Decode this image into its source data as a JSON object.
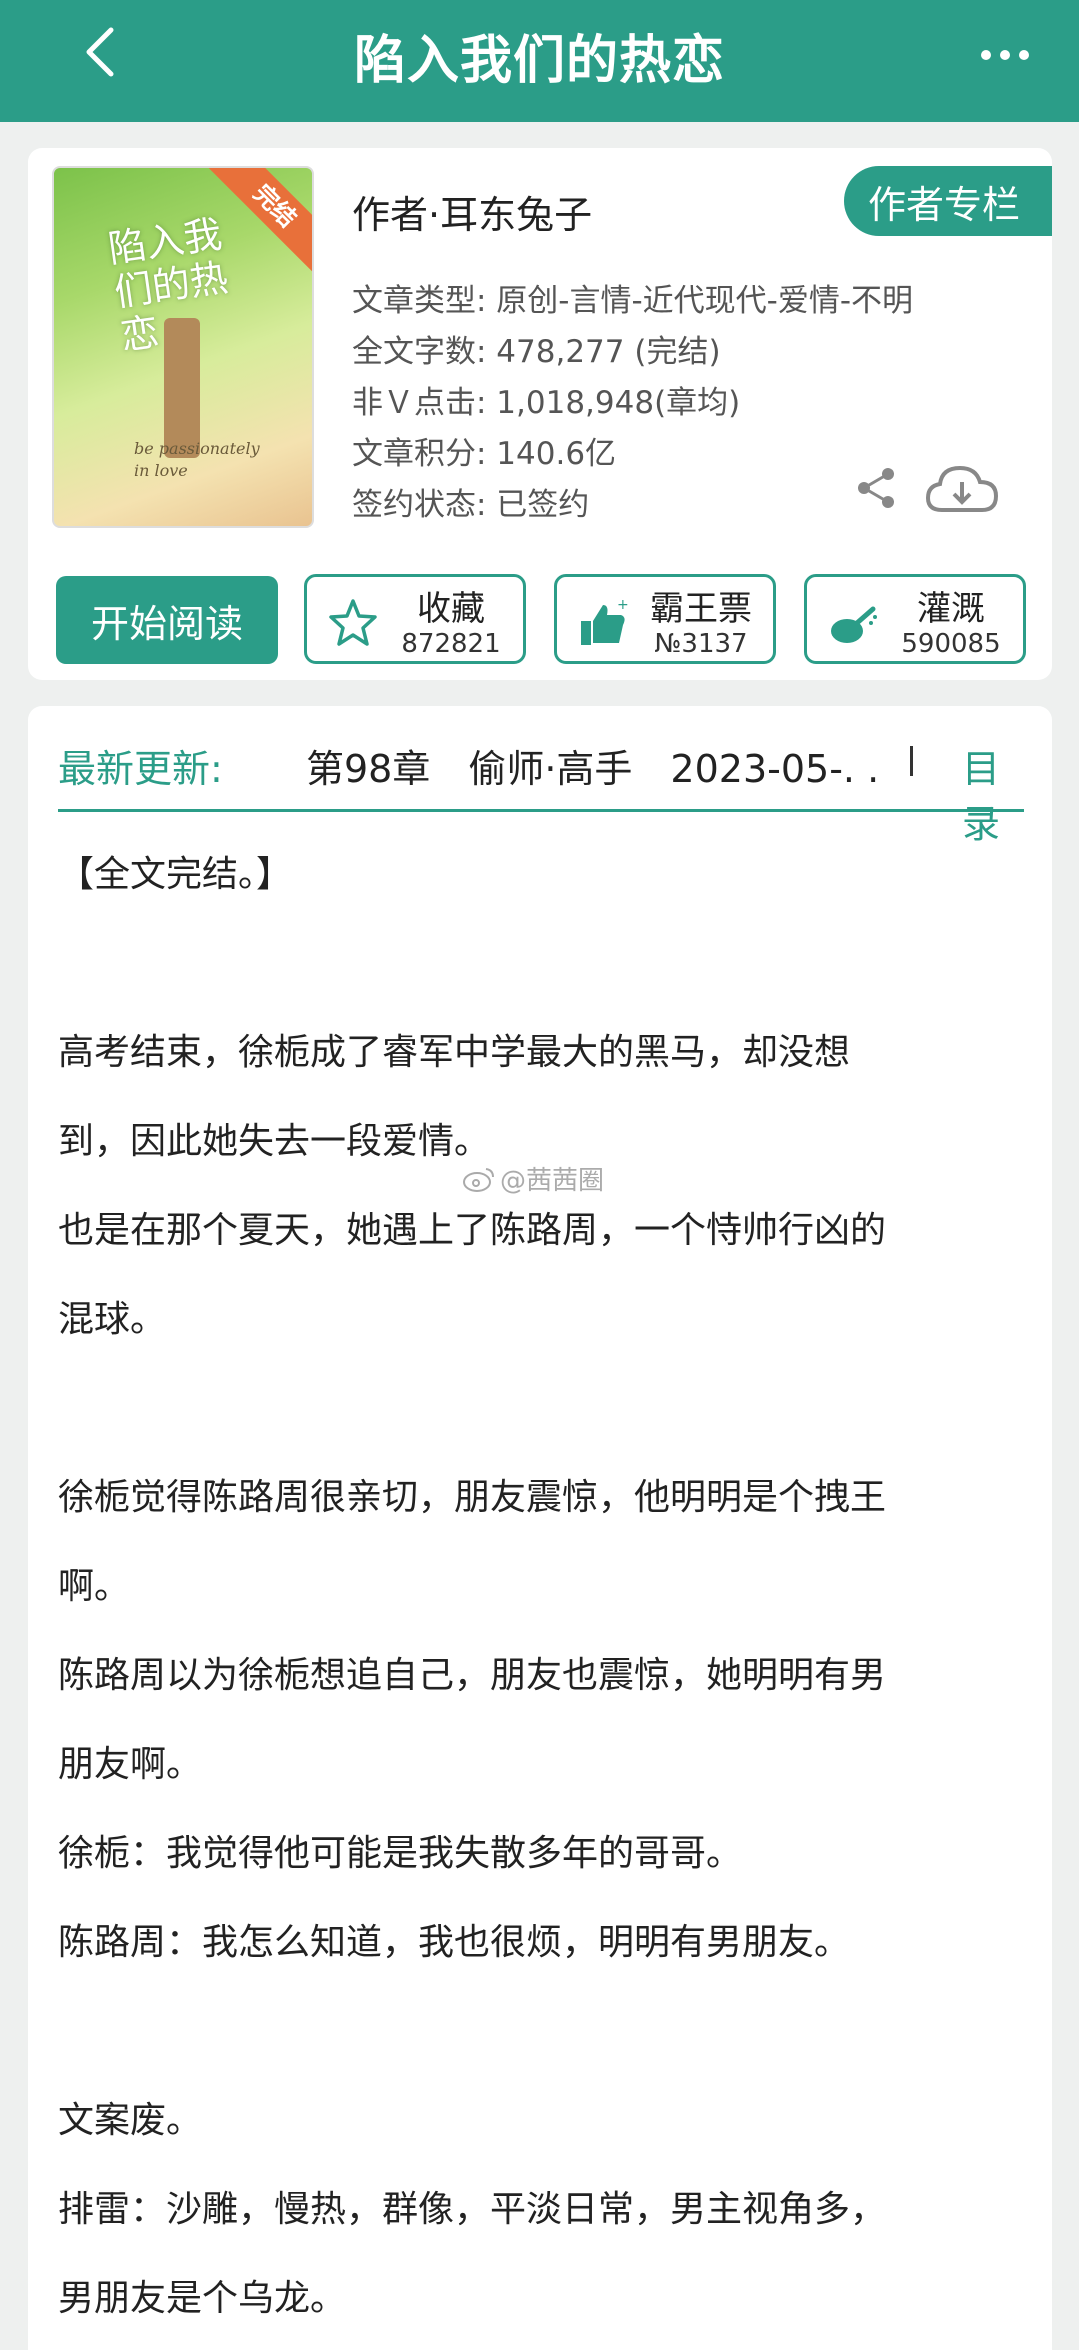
{
  "header": {
    "title": "陷入我们的热恋"
  },
  "book": {
    "cover_badge": "完结",
    "cover_title": "陷入我们的热恋",
    "cover_subtitle": "be passionately in love",
    "author_line": "作者·耳东兔子",
    "author_button": "作者专栏",
    "meta": [
      "文章类型: 原创-言情-近代现代-爱情-不明",
      "全文字数: 478,277 (完结)",
      "非Ｖ点击: 1,018,948(章均)",
      "文章积分: 140.6亿",
      "签约状态: 已签约"
    ]
  },
  "actions": {
    "start_reading": "开始阅读",
    "favorite": {
      "label": "收藏",
      "count": "872821"
    },
    "ticket": {
      "label": "霸王票",
      "count": "№3137"
    },
    "water": {
      "label": "灌溉",
      "count": "590085"
    }
  },
  "update": {
    "label": "最新更新:",
    "chapter": "第98章　偷师·高手　2023-05-. .",
    "toc": "目录"
  },
  "synopsis": [
    "【全文完结。】",
    "",
    "高考结束，徐栀成了睿军中学最大的黑马，却没想",
    "到，因此她失去一段爱情。",
    "也是在那个夏天，她遇上了陈路周，一个恃帅行凶的",
    "混球。",
    "",
    "徐栀觉得陈路周很亲切，朋友震惊，他明明是个拽王",
    "啊。",
    "陈路周以为徐栀想追自己，朋友也震惊，她明明有男",
    "朋友啊。",
    "徐栀：我觉得他可能是我失散多年的哥哥。",
    "陈路周：我怎么知道，我也很烦，明明有男朋友。",
    "",
    "文案废。",
    "排雷：沙雕，慢热，群像，平淡日常，男主视角多，",
    "男朋友是个乌龙。"
  ],
  "watermark": "@茜茜圈",
  "colors": {
    "accent": "#2b9d88",
    "badge": "#e8703a"
  },
  "icons": [
    "back-icon",
    "more-icon",
    "share-icon",
    "download-icon",
    "star-icon",
    "thumbs-up-icon",
    "watering-can-icon",
    "weibo-icon"
  ]
}
